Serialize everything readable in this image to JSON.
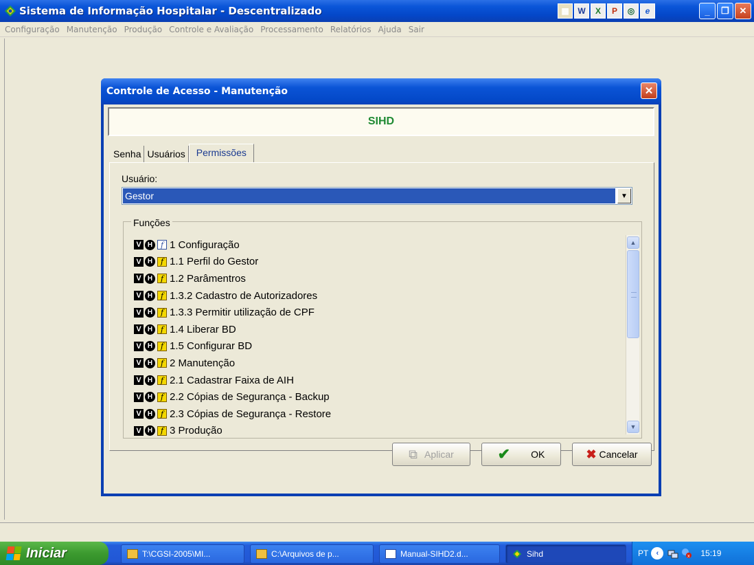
{
  "app": {
    "title": "Sistema de Informação Hospitalar - Descentralizado",
    "toolbar_icons": [
      "grid-icon",
      "word-icon",
      "excel-icon",
      "powerpoint-icon",
      "outlook-icon",
      "ie-icon"
    ]
  },
  "menu": [
    "Configuração",
    "Manutenção",
    "Produção",
    "Controle e Avaliação",
    "Processamento",
    "Relatórios",
    "Ajuda",
    "Sair"
  ],
  "dialog": {
    "title": "Controle de Acesso - Manutenção",
    "banner": "SIHD",
    "tabs": [
      {
        "label": "Senha",
        "active": false
      },
      {
        "label": "Usuários",
        "active": false
      },
      {
        "label": "Permissões",
        "active": true
      }
    ],
    "usuario_label": "Usuário:",
    "usuario_value": "Gestor",
    "funcoes_label": "Funções",
    "funcoes": [
      "1 Configuração",
      "1.1 Perfil do Gestor",
      "1.2 Parâmentros",
      "1.3.2 Cadastro de Autorizadores",
      "1.3.3 Permitir utilização de CPF",
      "1.4 Liberar BD",
      "1.5 Configurar BD",
      "2 Manutenção",
      "2.1 Cadastrar Faixa de AIH",
      "2.2 Cópias de Segurança - Backup",
      "2.3 Cópias de Segurança - Restore",
      "3 Produção"
    ],
    "icon_v": "V",
    "icon_h": "H",
    "icon_f": "f",
    "buttons": {
      "aplicar": "Aplicar",
      "ok": "OK",
      "cancelar": "Cancelar"
    }
  },
  "taskbar": {
    "start": "Iniciar",
    "tasks": [
      "T:\\CGSI-2005\\MI...",
      "C:\\Arquivos de p...",
      "Manual-SIHD2.d...",
      "Sihd"
    ],
    "lang": "PT",
    "clock": "15:19"
  },
  "colors": {
    "title_blue": "#0a55d8",
    "banner_green": "#1f8a33",
    "selection_blue": "#2a58b8",
    "start_green": "#3c9a2f"
  }
}
